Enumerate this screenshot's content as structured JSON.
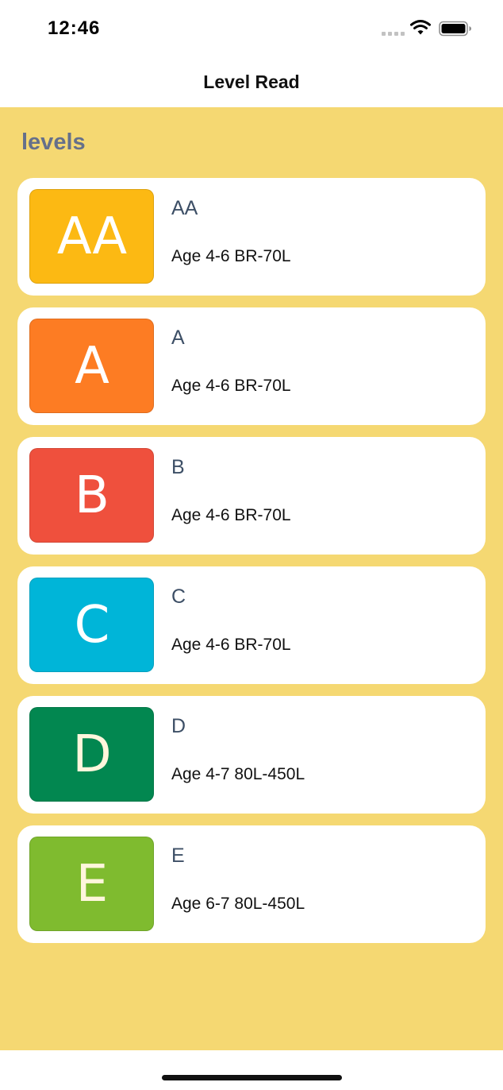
{
  "status_bar": {
    "time": "12:46"
  },
  "nav": {
    "title": "Level Read"
  },
  "section": {
    "title": "levels"
  },
  "levels": [
    {
      "badge": "AA",
      "title": "AA",
      "subtitle": "Age 4-6 BR-70L",
      "color": "#fcb913"
    },
    {
      "badge": "A",
      "title": "A",
      "subtitle": "Age 4-6 BR-70L",
      "color": "#fd7c23"
    },
    {
      "badge": "B",
      "title": "B",
      "subtitle": "Age 4-6 BR-70L",
      "color": "#ef503d"
    },
    {
      "badge": "C",
      "title": "C",
      "subtitle": "Age 4-6 BR-70L",
      "color": "#00b5d8"
    },
    {
      "badge": "D",
      "title": "D",
      "subtitle": "Age 4-7 80L-450L",
      "color": "#028750"
    },
    {
      "badge": "E",
      "title": "E",
      "subtitle": "Age 6-7 80L-450L",
      "color": "#7fbb2f"
    }
  ]
}
